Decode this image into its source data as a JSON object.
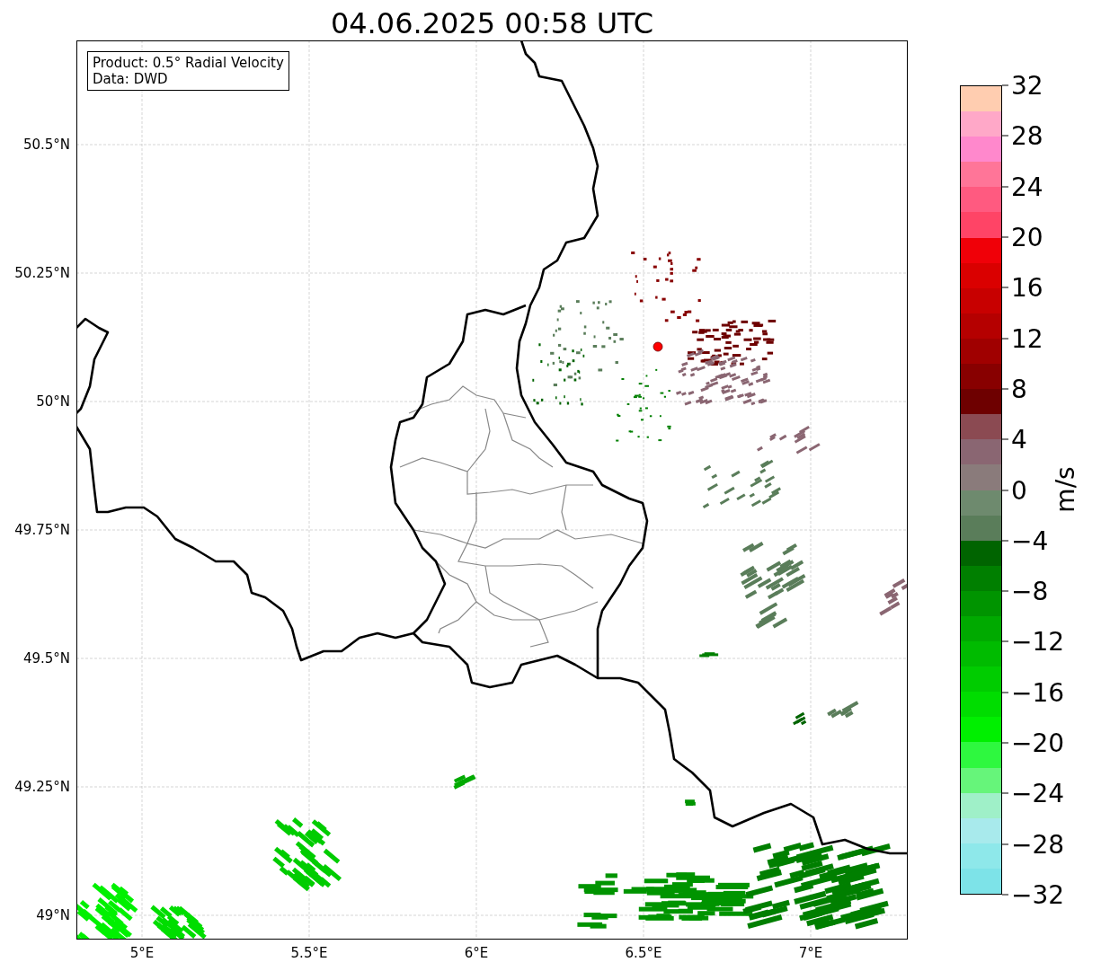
{
  "title": "04.06.2025 00:58 UTC",
  "legend": [
    "Product: 0.5° Radial Velocity",
    "Data: DWD"
  ],
  "map": {
    "xticks": [
      "5°E",
      "5.5°E",
      "6°E",
      "6.5°E",
      "7°E"
    ],
    "yticks": [
      "50.5°N",
      "50.25°N",
      "50°N",
      "49.75°N",
      "49.5°N",
      "49.25°N",
      "49°N"
    ]
  },
  "colorbar": {
    "label": "m/s",
    "ticks": [
      "32",
      "28",
      "24",
      "20",
      "16",
      "12",
      "8",
      "4",
      "0",
      "−4",
      "−8",
      "−12",
      "−16",
      "−20",
      "−24",
      "−28",
      "−32"
    ],
    "segments": [
      {
        "color": "#ffcdb0"
      },
      {
        "color": "#ffa8c8"
      },
      {
        "color": "#ff88cc"
      },
      {
        "color": "#ff7598"
      },
      {
        "color": "#ff5a80"
      },
      {
        "color": "#ff4466"
      },
      {
        "color": "#f00008"
      },
      {
        "color": "#da0000"
      },
      {
        "color": "#c80000"
      },
      {
        "color": "#b50000"
      },
      {
        "color": "#a00000"
      },
      {
        "color": "#880000"
      },
      {
        "color": "#6e0000"
      },
      {
        "color": "#8b4a52"
      },
      {
        "color": "#8a6672"
      },
      {
        "color": "#8a7b7b"
      },
      {
        "color": "#6e8a6e"
      },
      {
        "color": "#5a7d5a"
      },
      {
        "color": "#006400"
      },
      {
        "color": "#007f00"
      },
      {
        "color": "#009400"
      },
      {
        "color": "#00aa00"
      },
      {
        "color": "#00bb00"
      },
      {
        "color": "#00cc00"
      },
      {
        "color": "#00dd00"
      },
      {
        "color": "#00f000"
      },
      {
        "color": "#2ef83f"
      },
      {
        "color": "#66f57a"
      },
      {
        "color": "#9ff0c8"
      },
      {
        "color": "#a8eaec"
      },
      {
        "color": "#8ee8ea"
      },
      {
        "color": "#7de3e8"
      }
    ]
  }
}
